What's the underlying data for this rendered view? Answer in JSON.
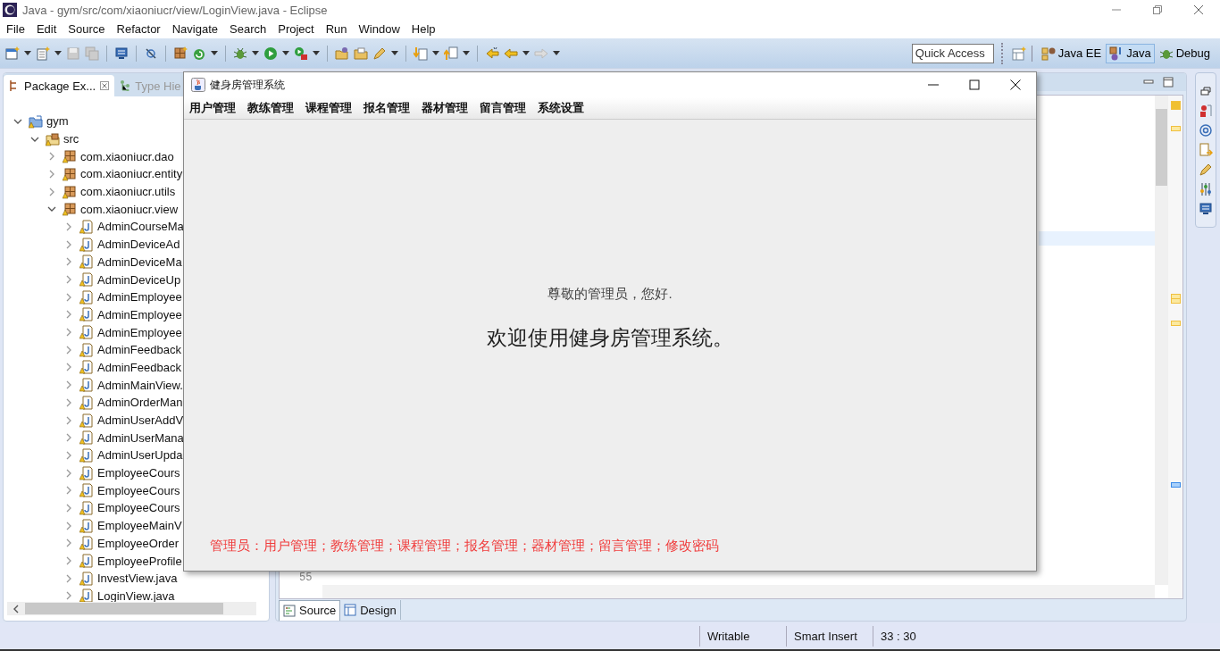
{
  "window": {
    "title": "Java - gym/src/com/xiaoniucr/view/LoginView.java - Eclipse"
  },
  "menu": [
    "File",
    "Edit",
    "Source",
    "Refactor",
    "Navigate",
    "Search",
    "Project",
    "Run",
    "Window",
    "Help"
  ],
  "toolbar": {
    "quick_access": {
      "placeholder": "Quick Access"
    },
    "perspectives": [
      {
        "label": "Java EE",
        "selected": false
      },
      {
        "label": "Java",
        "selected": true
      },
      {
        "label": "Debug",
        "selected": false
      }
    ]
  },
  "package_explorer": {
    "tabs": [
      {
        "label": "Package Ex...",
        "selected": true
      },
      {
        "label": "Type Hie",
        "selected": false
      }
    ],
    "tree": [
      {
        "label": "gym",
        "kind": "project",
        "expanded": true,
        "children": [
          {
            "label": "src",
            "kind": "folder",
            "expanded": true,
            "children": [
              {
                "label": "com.xiaoniucr.dao",
                "kind": "package",
                "expanded": false
              },
              {
                "label": "com.xiaoniucr.entity",
                "kind": "package",
                "expanded": false
              },
              {
                "label": "com.xiaoniucr.utils",
                "kind": "package",
                "expanded": false
              },
              {
                "label": "com.xiaoniucr.view",
                "kind": "package",
                "expanded": true,
                "children": [
                  {
                    "label": "AdminCourseMa",
                    "kind": "file",
                    "expanded": false
                  },
                  {
                    "label": "AdminDeviceAd",
                    "kind": "file",
                    "expanded": false
                  },
                  {
                    "label": "AdminDeviceMa",
                    "kind": "file",
                    "expanded": false
                  },
                  {
                    "label": "AdminDeviceUp",
                    "kind": "file",
                    "expanded": false
                  },
                  {
                    "label": "AdminEmployee",
                    "kind": "file",
                    "expanded": false
                  },
                  {
                    "label": "AdminEmployee",
                    "kind": "file",
                    "expanded": false
                  },
                  {
                    "label": "AdminEmployee",
                    "kind": "file",
                    "expanded": false
                  },
                  {
                    "label": "AdminFeedback",
                    "kind": "file",
                    "expanded": false
                  },
                  {
                    "label": "AdminFeedback",
                    "kind": "file",
                    "expanded": false
                  },
                  {
                    "label": "AdminMainView.",
                    "kind": "file",
                    "expanded": false
                  },
                  {
                    "label": "AdminOrderMan",
                    "kind": "file",
                    "expanded": false
                  },
                  {
                    "label": "AdminUserAddV",
                    "kind": "file",
                    "expanded": false
                  },
                  {
                    "label": "AdminUserMana",
                    "kind": "file",
                    "expanded": false
                  },
                  {
                    "label": "AdminUserUpda",
                    "kind": "file",
                    "expanded": false
                  },
                  {
                    "label": "EmployeeCours",
                    "kind": "file",
                    "expanded": false
                  },
                  {
                    "label": "EmployeeCours",
                    "kind": "file",
                    "expanded": false
                  },
                  {
                    "label": "EmployeeCours",
                    "kind": "file",
                    "expanded": false
                  },
                  {
                    "label": "EmployeeMainV",
                    "kind": "file",
                    "expanded": false
                  },
                  {
                    "label": "EmployeeOrder",
                    "kind": "file",
                    "expanded": false
                  },
                  {
                    "label": "EmployeeProfile",
                    "kind": "file",
                    "expanded": false
                  },
                  {
                    "label": "InvestView.java",
                    "kind": "file",
                    "expanded": false
                  },
                  {
                    "label": "LoginView.java",
                    "kind": "file",
                    "expanded": false
                  }
                ]
              }
            ]
          }
        ]
      }
    ]
  },
  "editor": {
    "line_numbers": [
      "55"
    ],
    "tabs": [
      {
        "label": "Source",
        "selected": true
      },
      {
        "label": "Design",
        "selected": false
      }
    ]
  },
  "status_bar": [
    "Writable",
    "Smart Insert",
    "33 : 30"
  ],
  "app_window": {
    "title": "健身房管理系统",
    "menu": [
      "用户管理",
      "教练管理",
      "课程管理",
      "报名管理",
      "器材管理",
      "留言管理",
      "系统设置"
    ],
    "greeting": "尊敬的管理员，您好.",
    "welcome": "欢迎使用健身房管理系统。",
    "footer": "管理员：用户管理；教练管理；课程管理；报名管理；器材管理；留言管理；修改密码"
  }
}
